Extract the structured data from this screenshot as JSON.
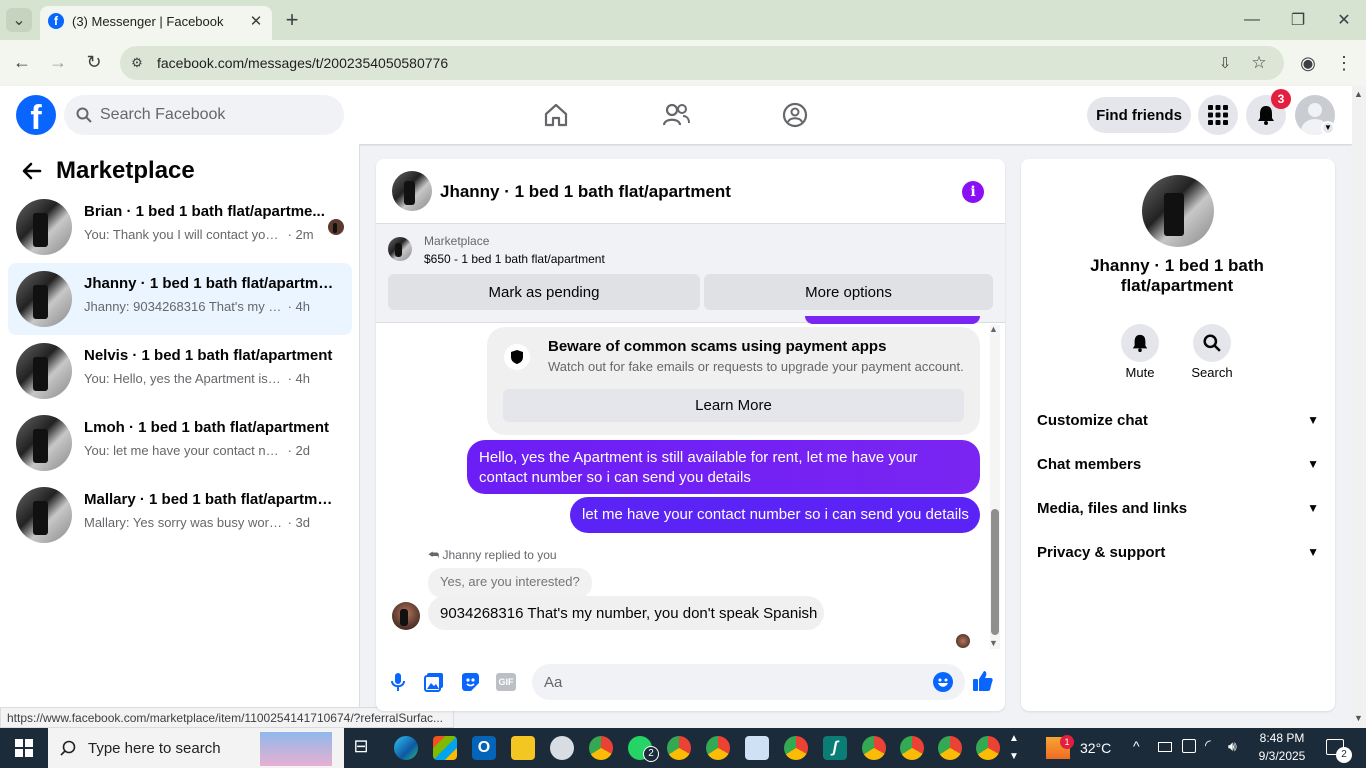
{
  "browser": {
    "tab_title": "(3) Messenger | Facebook",
    "url": "facebook.com/messages/t/2002354050580776",
    "status_url": "https://www.facebook.com/marketplace/item/1100254141710674/?referralSurfac..."
  },
  "header": {
    "search_placeholder": "Search Facebook",
    "find_friends": "Find friends",
    "notification_count": "3"
  },
  "sidebar": {
    "title": "Marketplace",
    "conversations": [
      {
        "title": "Brian · 1 bed 1 bath flat/apartme...",
        "preview": "You: Thank you I will contact you v...",
        "time": " · 2m"
      },
      {
        "title": "Jhanny · 1 bed 1 bath flat/apartment",
        "preview": "Jhanny: 9034268316 That's my numbe...",
        "time": " · 4h"
      },
      {
        "title": "Nelvis · 1 bed 1 bath flat/apartment",
        "preview": "You: Hello, yes the Apartment is still a...",
        "time": " · 4h"
      },
      {
        "title": "Lmoh · 1 bed 1 bath flat/apartment",
        "preview": "You: let me have your contact number...",
        "time": " · 2d"
      },
      {
        "title": "Mallary · 1 bed 1 bath flat/apartme...",
        "preview": "Mallary: Yes sorry was busy working 9...",
        "time": " · 3d"
      }
    ]
  },
  "chat": {
    "title": "Jhanny · 1 bed 1 bath flat/apartment",
    "listing_label": "Marketplace",
    "listing_detail": "$650 - 1 bed 1 bath flat/apartment",
    "mark_pending": "Mark as pending",
    "more_options": "More options",
    "warning_title": "Beware of common scams using payment apps",
    "warning_text": "Watch out for fake emails or requests to upgrade your payment account.",
    "learn_more": "Learn More",
    "msg_out_1": "Hello, yes the Apartment is still available for rent, let me have your contact number so i can send you details",
    "msg_out_2": "let me have your contact number so i can send you details",
    "reply_label": "Jhanny replied to you",
    "reply_quote": "Yes, are you interested?",
    "msg_in": "9034268316 That's my number, you don't speak Spanish",
    "composer_placeholder": "Aa"
  },
  "details": {
    "name": "Jhanny · 1 bed 1 bath flat/apartment",
    "mute": "Mute",
    "search": "Search",
    "sections": [
      "Customize chat",
      "Chat members",
      "Media, files and links",
      "Privacy & support"
    ]
  },
  "taskbar": {
    "search_placeholder": "Type here to search",
    "weather": "32°C",
    "time": "8:48 PM",
    "date": "9/3/2025",
    "whatsapp_badge": "2",
    "notif_badge": "2",
    "weather_badge": "1"
  },
  "colors": {
    "fb_blue": "#0866ff",
    "messenger_purple": "#7a25f2",
    "badge_red": "#e41e3f"
  }
}
